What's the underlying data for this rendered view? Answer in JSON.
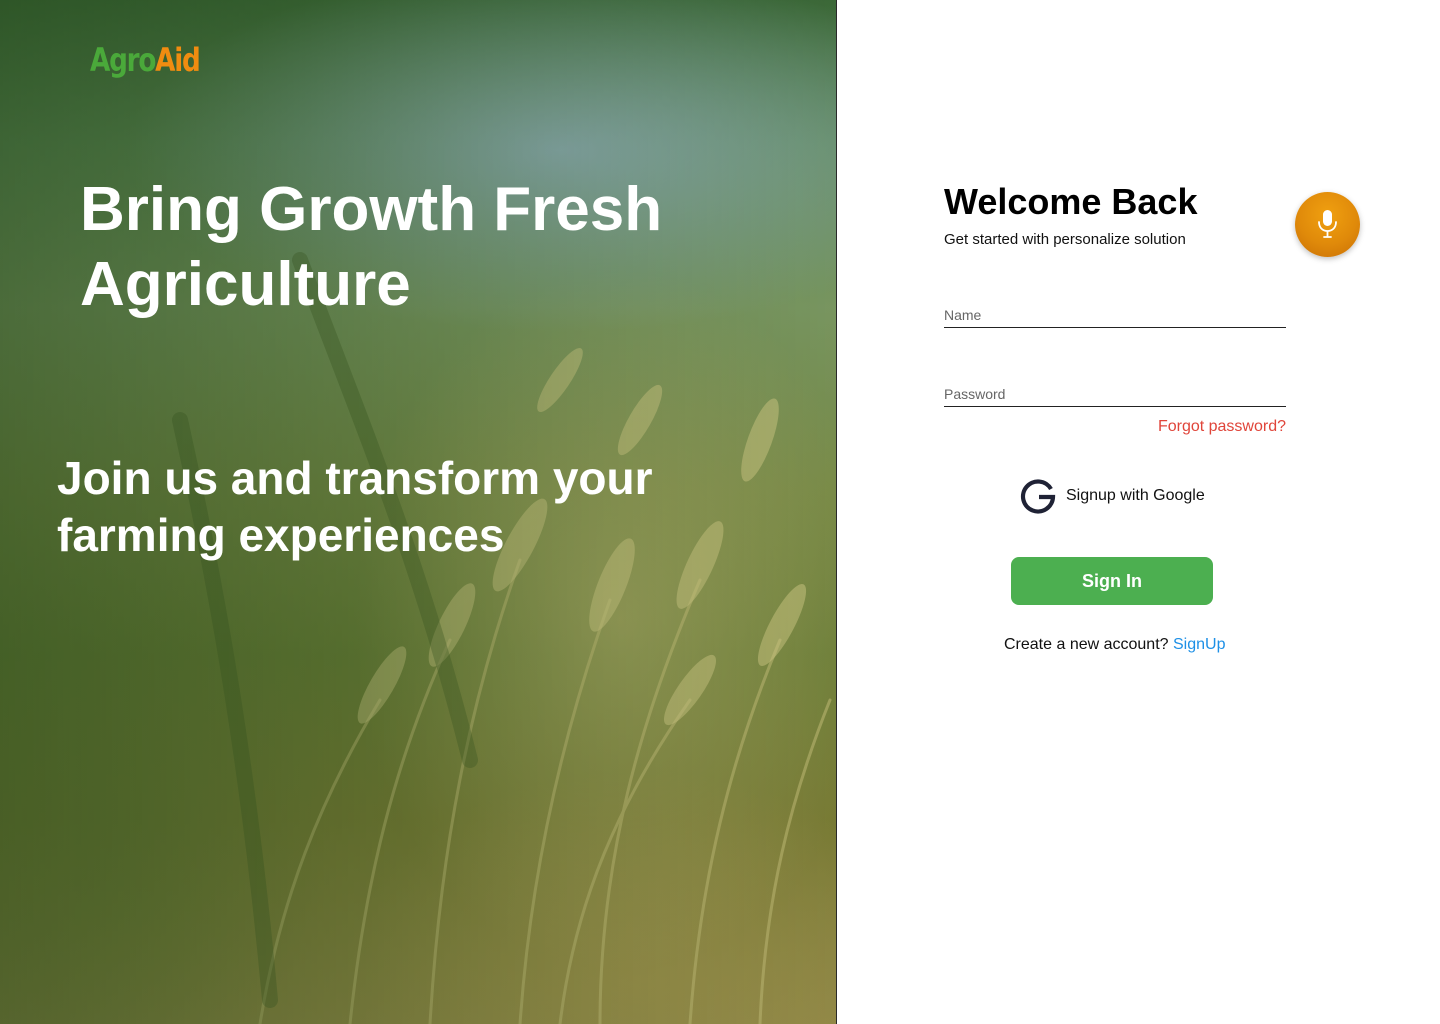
{
  "brand": {
    "part1": "Agro",
    "part2": "Aid",
    "color_part1": "#4aa93a",
    "color_part2": "#f08c10"
  },
  "hero": {
    "headline": "Bring Growth Fresh Agriculture",
    "subheadline": "Join us and transform your farming experiences",
    "background": "wheat-field-photo"
  },
  "form": {
    "title": "Welcome Back",
    "subtitle": "Get started with personalize solution",
    "mic_icon": "microphone-icon",
    "name_placeholder": "Name",
    "name_value": "",
    "password_placeholder": "Password",
    "password_value": "",
    "forgot_label": "Forgot password?",
    "google_icon": "google-g-icon",
    "google_label": "Signup with Google",
    "signin_label": "Sign In",
    "signup_prompt": "Create a new account?",
    "signup_link": "SignUp"
  },
  "colors": {
    "primary_green": "#4caf50",
    "accent_orange": "#e08a0a",
    "link_blue": "#1e90e6",
    "error_red": "#e0453a"
  }
}
